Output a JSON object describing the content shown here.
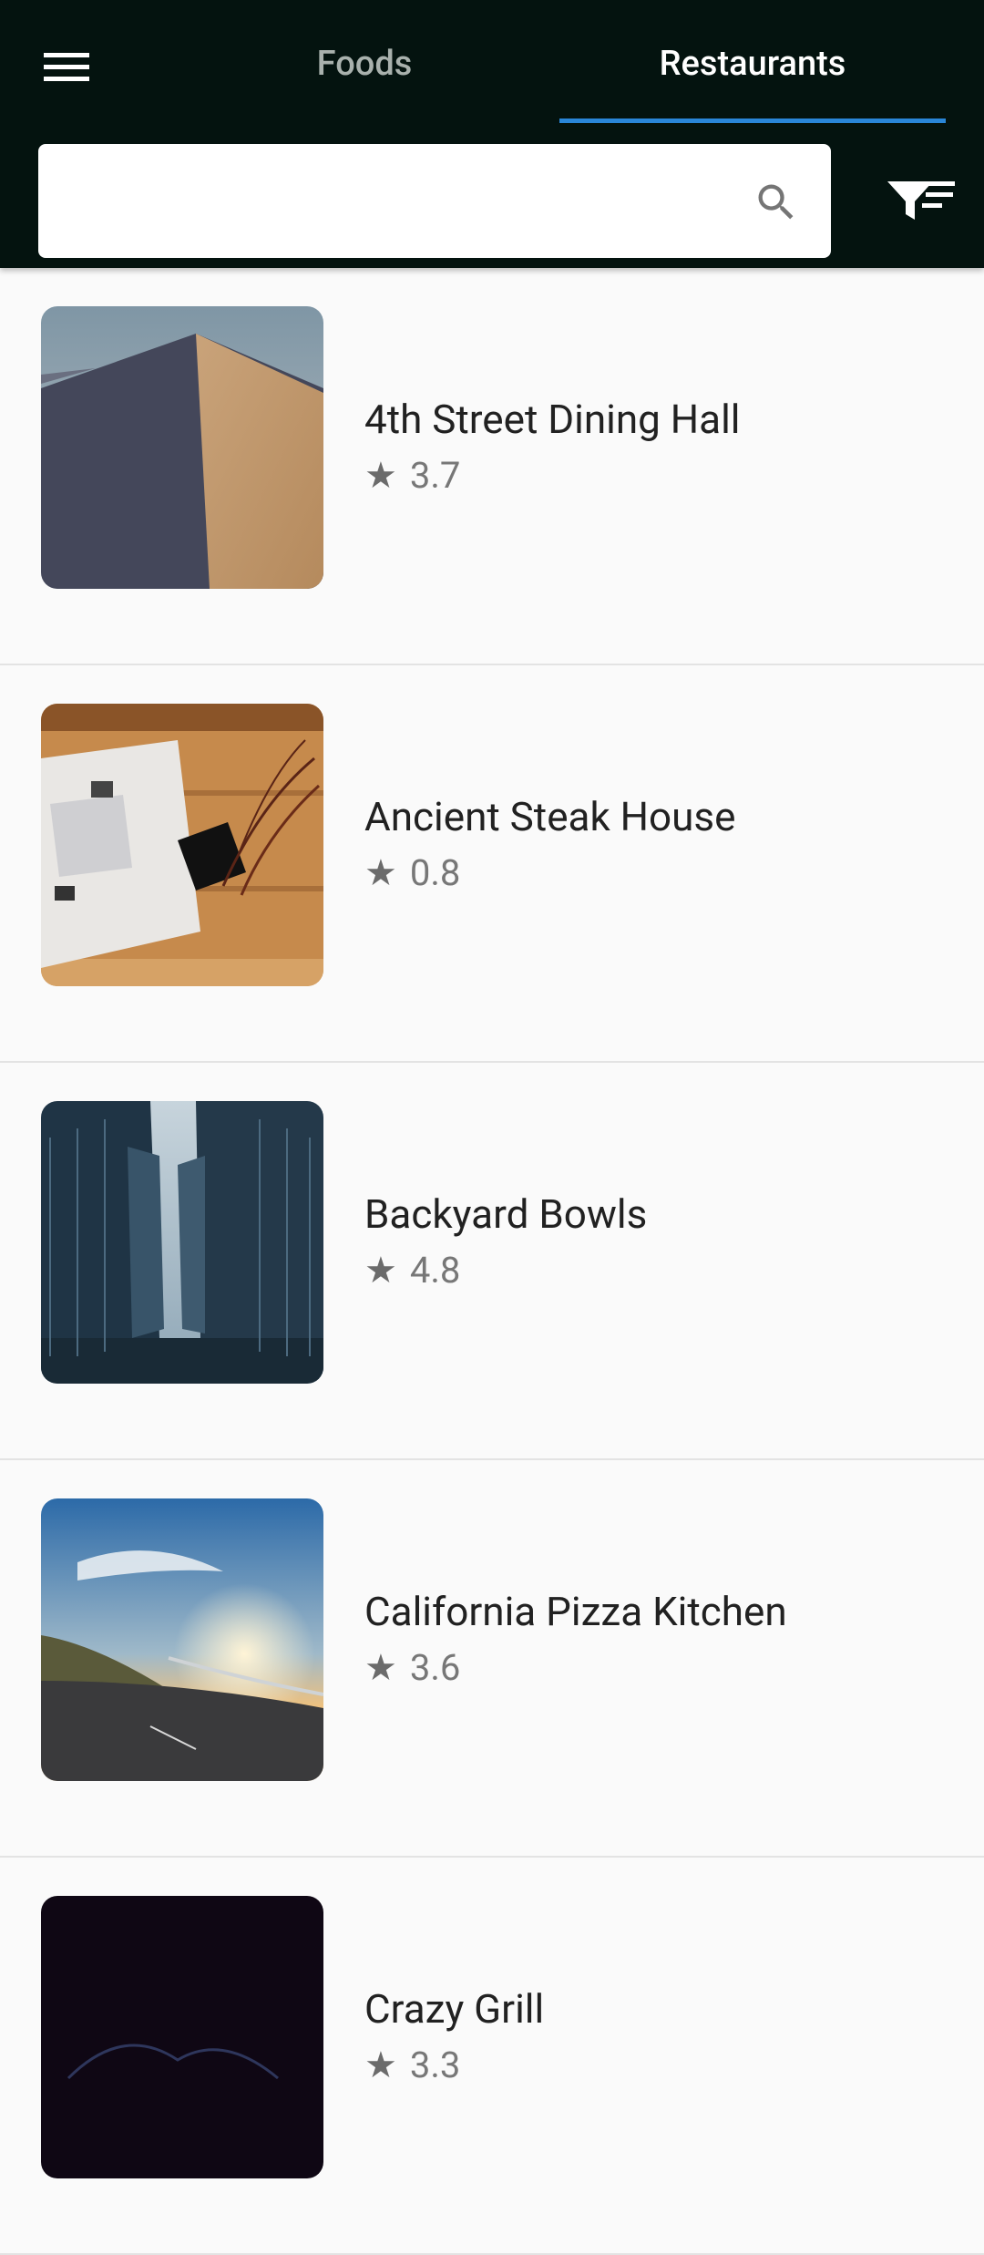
{
  "tabs": {
    "foods": "Foods",
    "restaurants": "Restaurants",
    "active": "restaurants"
  },
  "search": {
    "value": "",
    "placeholder": ""
  },
  "colors": {
    "appbar": "#04130f",
    "indicator": "#2a86d8",
    "background": "#fafafa"
  },
  "icons": {
    "menu": "hamburger-menu-icon",
    "search": "magnifier-icon",
    "filter": "filter-funnel-icon",
    "rating": "star-icon"
  },
  "restaurants": [
    {
      "name": "4th Street Dining Hall",
      "rating": "3.7",
      "image": "desert-dune"
    },
    {
      "name": "Ancient Steak House",
      "rating": "0.8",
      "image": "book-on-wood-table"
    },
    {
      "name": "Backyard Bowls",
      "rating": "4.8",
      "image": "city-skyscrapers"
    },
    {
      "name": "California Pizza Kitchen",
      "rating": "3.6",
      "image": "sunset-road"
    },
    {
      "name": "Crazy Grill",
      "rating": "3.3",
      "image": "dark-night"
    }
  ]
}
